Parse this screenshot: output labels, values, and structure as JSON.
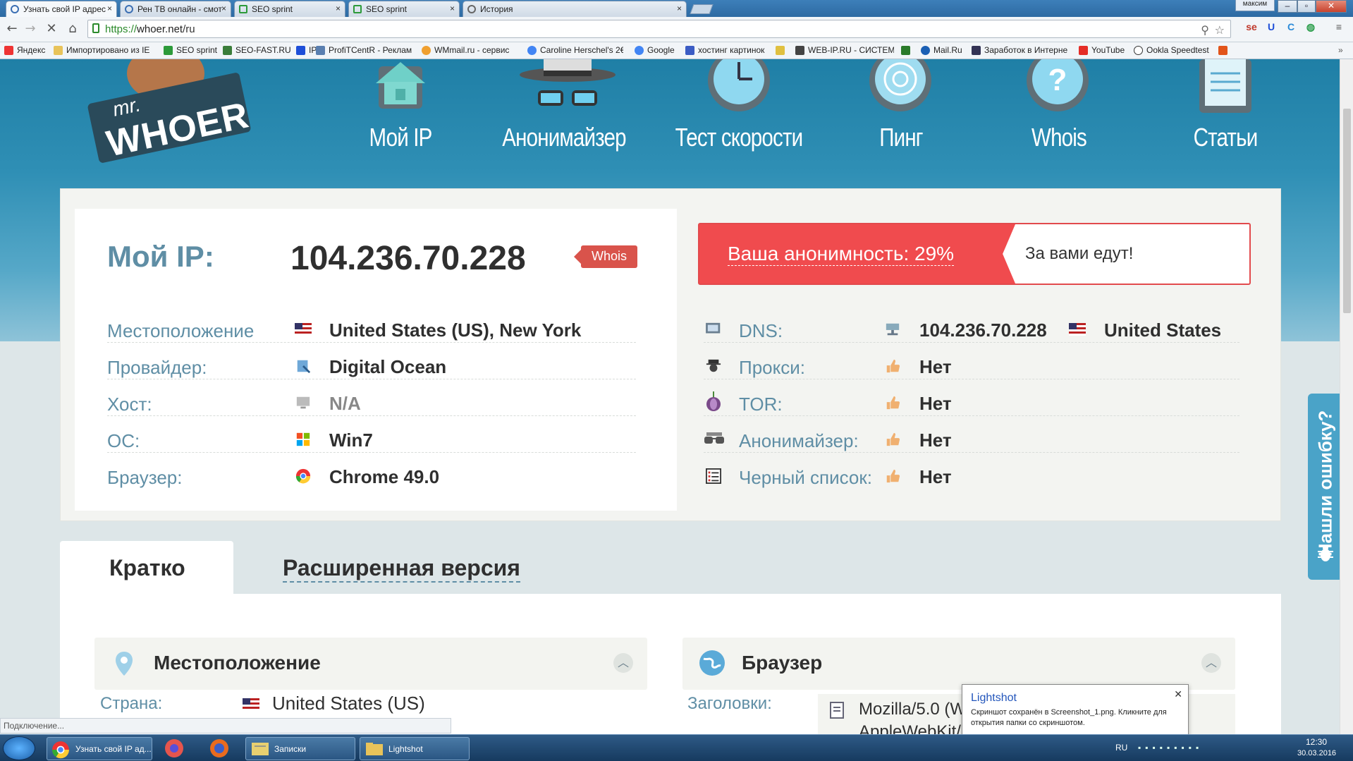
{
  "browser": {
    "tabs": [
      {
        "label": "Узнать свой IP адрес",
        "active": true
      },
      {
        "label": "Рен ТВ онлайн - смот"
      },
      {
        "label": "SEO sprint"
      },
      {
        "label": "SEO sprint"
      },
      {
        "label": "История"
      }
    ],
    "user": "максим",
    "url_scheme": "https://",
    "url_host": "whoer.net",
    "url_path": "/ru",
    "bookmarks": [
      "Яндекс",
      "Импортировано из IE",
      "SEO sprint",
      "SEO-FAST.RU",
      "IP",
      "ProfiTCentR - Реклам",
      "WMmail.ru - сервис",
      "Caroline Herschel's 2€",
      "Google",
      "хостинг картинок",
      "",
      "WEB-IP.RU - СИСТЕМ",
      "",
      "Mail.Ru",
      "Заработок в Интерне",
      "YouTube",
      "Ookla Speedtest"
    ],
    "status": "Подключение..."
  },
  "site": {
    "logo_mr": "mr.",
    "logo_name": "WHOER",
    "nav": [
      "Мой IP",
      "Анонимайзер",
      "Тест скорости",
      "Пинг",
      "Whois",
      "Статьи"
    ]
  },
  "ipcard": {
    "label": "Мой IP:",
    "ip": "104.236.70.228",
    "whois": "Whois",
    "rows": [
      {
        "label": "Местоположение",
        "value": "United States (US), New York"
      },
      {
        "label": "Провайдер:",
        "value": "Digital Ocean"
      },
      {
        "label": "Хост:",
        "value": "N/A"
      },
      {
        "label": "ОС:",
        "value": "Win7"
      },
      {
        "label": "Браузер:",
        "value": "Chrome 49.0"
      }
    ]
  },
  "anonymity": {
    "title": "Ваша анонимность: 29%",
    "percent": 29,
    "desc": "За вами едут!",
    "rows": [
      {
        "label": "DNS:",
        "value": "104.236.70.228",
        "extra": "United States"
      },
      {
        "label": "Прокси:",
        "value": "Нет"
      },
      {
        "label": "TOR:",
        "value": "Нет"
      },
      {
        "label": "Анонимайзер:",
        "value": "Нет"
      },
      {
        "label": "Черный список:",
        "value": "Нет"
      }
    ]
  },
  "tabs2": {
    "brief": "Кратко",
    "extended": "Расширенная версия"
  },
  "location_box": {
    "title": "Местоположение",
    "country_label": "Страна:",
    "country_value": "United States (US)"
  },
  "browser_box": {
    "title": "Браузер",
    "headers_label": "Заголовки:",
    "headers_value": "Mozilla/5.0 (W",
    "headers_value2": "AppleWebKit/5"
  },
  "feedback": "Нашли ошибку?",
  "lightshot": {
    "title": "Lightshot",
    "message": "Скриншот сохранён в Screenshot_1.png. Кликните для открытия папки со скриншотом."
  },
  "taskbar": {
    "items": [
      "Узнать свой IP ад...",
      "",
      "",
      "Записки",
      "Lightshot"
    ],
    "lang": "RU",
    "time": "12:30",
    "date": "30.03.2016"
  },
  "colors": {
    "accent": "#5f8ea5",
    "danger": "#f04b4e",
    "hero": "#2f8fb5"
  }
}
